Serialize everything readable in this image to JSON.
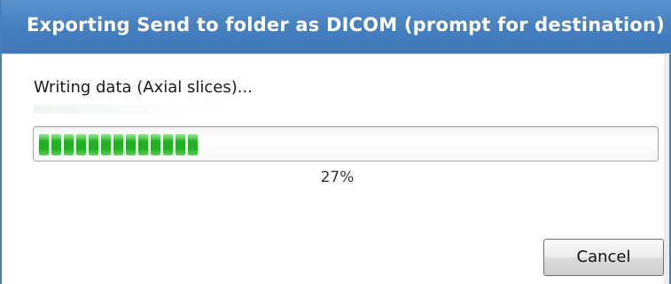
{
  "window": {
    "title": "Exporting Send to folder as DICOM (prompt for destination)"
  },
  "status": {
    "message": "Writing data (Axial slices)..."
  },
  "progress": {
    "fraction": 0.27,
    "percent_label": "27%",
    "segment_color": "#22b022"
  },
  "buttons": {
    "cancel_label": "Cancel"
  },
  "colors": {
    "titlebar": "#4680c0",
    "title_text": "#ffffff"
  }
}
